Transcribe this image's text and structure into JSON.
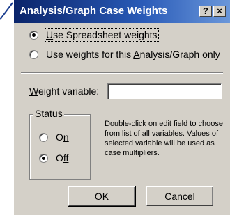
{
  "title": "Analysis/Graph Case Weights",
  "title_buttons": {
    "help": "?",
    "close": "×"
  },
  "options": {
    "spreadsheet": {
      "pre": "",
      "ul": "U",
      "post": "se Spreadsheet weights",
      "checked": true
    },
    "analysis": {
      "pre": "Use weights for this ",
      "ul": "A",
      "post": "nalysis/Graph only",
      "checked": false
    }
  },
  "weight": {
    "ul": "W",
    "post": "eight variable:",
    "value": ""
  },
  "status": {
    "title": "Status",
    "on": {
      "pre": "O",
      "ul": "n",
      "checked": false
    },
    "off": {
      "pre": "O",
      "ul": "ff",
      "checked": true
    }
  },
  "help_text": "Double-click on edit field to choose from list of all variables. Values of selected variable will be used as case multipliers.",
  "buttons": {
    "ok": "OK",
    "cancel": "Cancel"
  },
  "colors": {
    "title_start": "#0a246a",
    "title_end": "#6a97da",
    "face": "#d4d0c8"
  }
}
